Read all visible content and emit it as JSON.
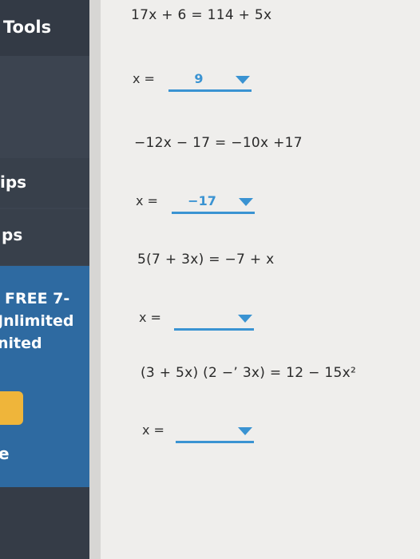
{
  "sidebar": {
    "tools_label": "Tools",
    "item_1_label": "ips",
    "item_2_label": "ps",
    "promo_lines": [
      "FREE 7-",
      "Jnlimited",
      "nited"
    ],
    "bottom_label": "e"
  },
  "problems": [
    {
      "equation": "17x + 6 = 114 + 5x",
      "x_label": "x =",
      "answer": "9"
    },
    {
      "equation": "−12x − 17 = −10x +17",
      "x_label": "x =",
      "answer": "−17"
    },
    {
      "equation": "5(7 + 3x) = −7 + x",
      "x_label": "x =",
      "answer": ""
    },
    {
      "equation": "(3 + 5x) (2 −ʼ 3x) = 12 − 15x²",
      "x_label": "x =",
      "answer": ""
    }
  ],
  "colors": {
    "accent": "#3a93d2",
    "sidebar_dark": "#3c4450",
    "sidebar_blue": "#2e6aa1",
    "promo_button": "#efb53a"
  },
  "icons": {
    "dropdown": "caret-down-icon"
  }
}
